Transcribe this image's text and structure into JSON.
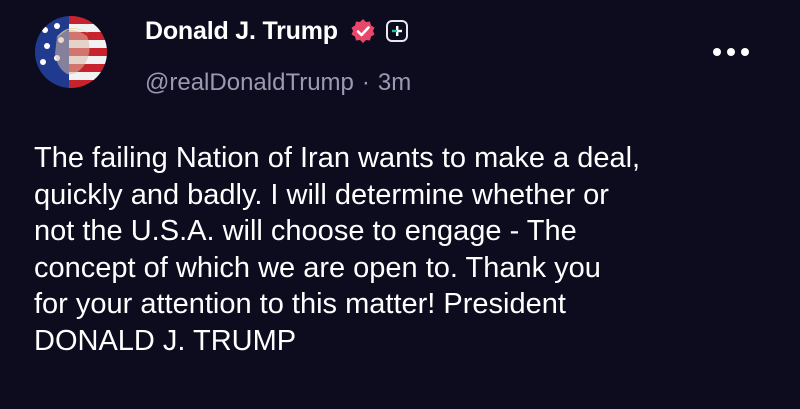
{
  "post": {
    "author": {
      "display_name": "Donald J. Trump",
      "handle": "@realDonaldTrump",
      "separator": "·",
      "time_ago": "3m",
      "verified": true,
      "avatar_icon": "avatar-flag-portrait",
      "badge_icon": "plus-badge-icon"
    },
    "body": "The failing Nation of Iran wants to make a deal,\nquickly and badly. I will determine whether or\nnot the U.S.A. will choose to engage - The\nconcept of which we are open to. Thank you\nfor your attention to this matter! President\nDONALD J. TRUMP",
    "more_icon": "more-options-icon"
  },
  "colors": {
    "background": "#0d0b1e",
    "text": "#ffffff",
    "muted": "#9c99b2",
    "verified_badge": "#e8476a",
    "plus_accent": "#22c4a0"
  }
}
